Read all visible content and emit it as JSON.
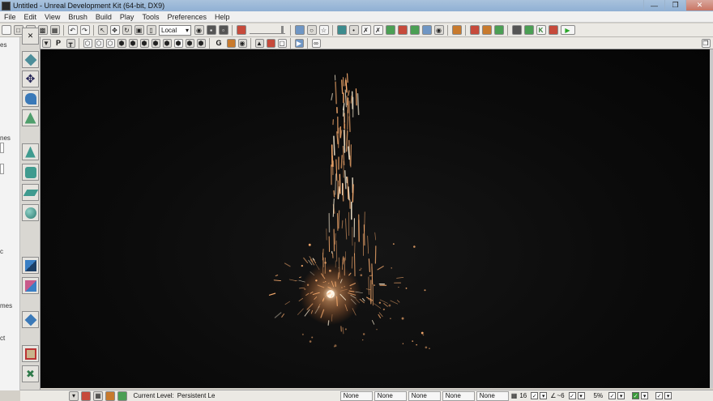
{
  "window": {
    "title": "Untitled - Unreal Development Kit (64-bit, DX9)",
    "controls": [
      "minimize-icon",
      "maximize-icon",
      "close-icon"
    ]
  },
  "menu": {
    "items": [
      "File",
      "Edit",
      "View",
      "Brush",
      "Build",
      "Play",
      "Tools",
      "Preferences",
      "Help"
    ]
  },
  "toolbar": {
    "coordinate_system": "Local"
  },
  "viewport_toolbar": {
    "perspective_letter": "P",
    "game_letter": "G"
  },
  "left_panel": {
    "labels": [
      "es",
      "nes",
      "c",
      "mes",
      "ct"
    ]
  },
  "status": {
    "current_level_label": "Current Level:",
    "current_level_value": "Persistent Le",
    "fields": [
      "None",
      "None",
      "None",
      "None",
      "None"
    ],
    "grid_size": "16",
    "rotation_snap": "~6",
    "scale_snap": "5%"
  },
  "colors": {
    "viewport_bg": "#0a0a0a",
    "spark": "#ffb070",
    "spark_core": "#fff2d8",
    "titlebar": "#9db8d6"
  }
}
